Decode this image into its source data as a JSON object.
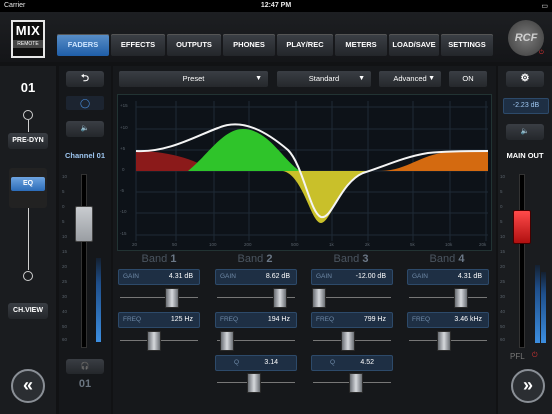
{
  "status_bar": {
    "carrier": "Carrier",
    "time": "12:47 PM"
  },
  "logo": {
    "top": "MIX",
    "bottom": "REMOTE"
  },
  "brand": "RCF",
  "tabs": [
    {
      "label": "FADERS",
      "active": true
    },
    {
      "label": "EFFECTS"
    },
    {
      "label": "OUTPUTS"
    },
    {
      "label": "PHONES"
    },
    {
      "label": "PLAY/REC"
    },
    {
      "label": "METERS"
    },
    {
      "label": "LOAD/SAVE"
    },
    {
      "label": "SETTINGS"
    }
  ],
  "left": {
    "channel_number": "01",
    "pre_dyn": "PRE-DYN",
    "eq": "EQ",
    "ch_view": "CH.VIEW",
    "channel_label": "Channel 01",
    "channel_bottom": "01",
    "fader_scale": [
      "10",
      "5",
      "0",
      "5",
      "10",
      "15",
      "20",
      "25",
      "30",
      "40",
      "50",
      "60"
    ]
  },
  "toolbar": {
    "preset": "Preset",
    "mode": "Standard",
    "advanced": "Advanced",
    "on": "ON"
  },
  "eq_graph": {
    "y_ticks": [
      "+15",
      "+10",
      "+5",
      "0",
      "-5",
      "-10",
      "-15"
    ],
    "x_ticks": [
      "20",
      "50",
      "100",
      "200",
      "500",
      "1k",
      "2k",
      "5k",
      "10k",
      "20k"
    ]
  },
  "bands": [
    {
      "title": "Band",
      "num": "1",
      "gain_label": "GAIN",
      "gain": "4.31 dB",
      "freq_label": "FREQ",
      "freq": "125 Hz"
    },
    {
      "title": "Band",
      "num": "2",
      "gain_label": "GAIN",
      "gain": "8.62 dB",
      "freq_label": "FREQ",
      "freq": "194 Hz",
      "q_label": "Q",
      "q": "3.14"
    },
    {
      "title": "Band",
      "num": "3",
      "gain_label": "GAIN",
      "gain": "-12.00 dB",
      "freq_label": "FREQ",
      "freq": "799 Hz",
      "q_label": "Q",
      "q": "4.52"
    },
    {
      "title": "Band",
      "num": "4",
      "gain_label": "GAIN",
      "gain": "4.31 dB",
      "freq_label": "FREQ",
      "freq": "3.46 kHz"
    }
  ],
  "right": {
    "level": "-2.23 dB",
    "main_out": "MAIN OUT",
    "pfl": "PFL",
    "fader_scale": [
      "10",
      "5",
      "0",
      "5",
      "10",
      "15",
      "20",
      "25",
      "30",
      "40",
      "50",
      "60"
    ]
  },
  "colors": {
    "accent": "#2b6cb8",
    "band1": "#8b1a1a",
    "band2": "#2fc42a",
    "band3": "#c9c02a",
    "band4": "#d46a10"
  }
}
